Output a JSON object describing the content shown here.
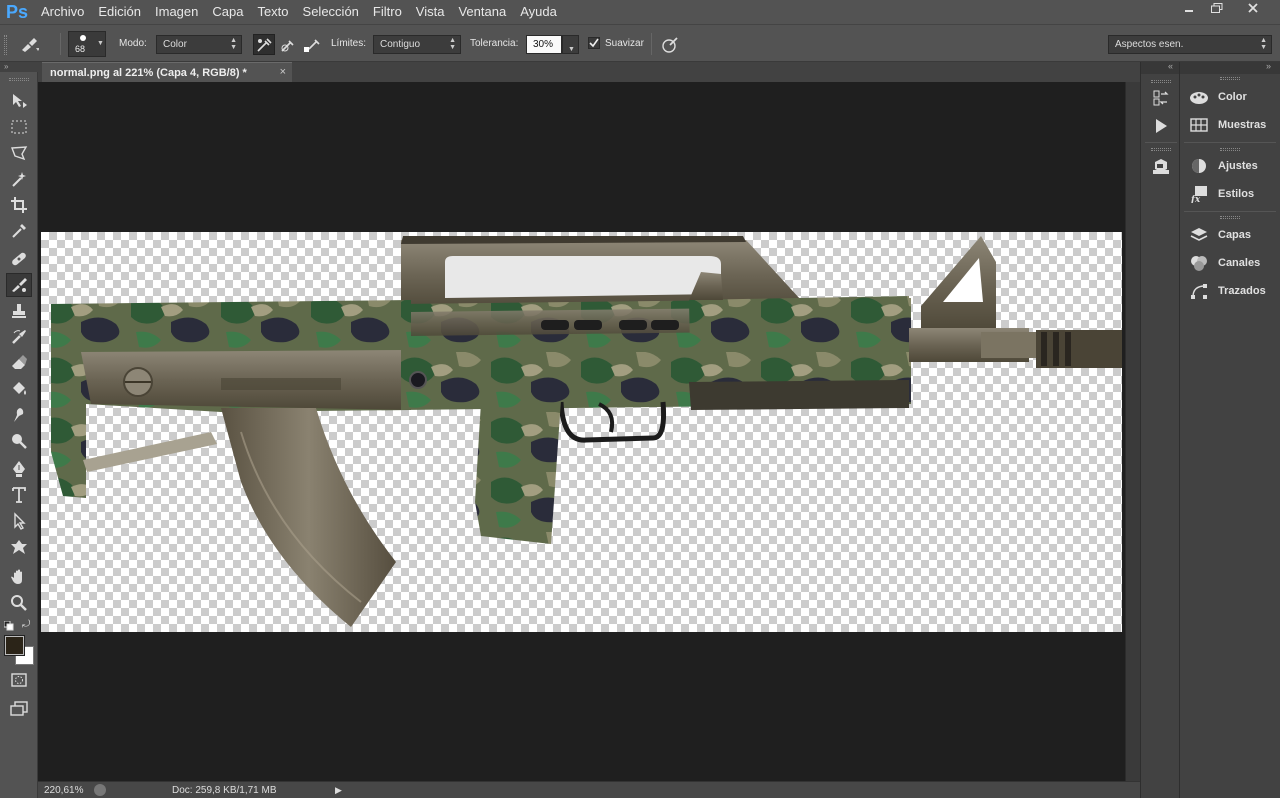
{
  "app": {
    "logo": "Ps"
  },
  "menu": [
    "Archivo",
    "Edición",
    "Imagen",
    "Capa",
    "Texto",
    "Selección",
    "Filtro",
    "Vista",
    "Ventana",
    "Ayuda"
  ],
  "options": {
    "brush_size": "68",
    "mode_label": "Modo:",
    "mode_value": "Color",
    "limits_label": "Límites:",
    "limits_value": "Contiguo",
    "tolerance_label": "Tolerancia:",
    "tolerance_value": "30%",
    "smooth_label": "Suavizar",
    "smooth_checked": true,
    "workspace_value": "Aspectos esen."
  },
  "document": {
    "tab_title": "normal.png al 221% (Capa 4, RGB/8) *",
    "close_glyph": "×"
  },
  "status": {
    "zoom": "220,61%",
    "doc_info": "Doc: 259,8 KB/1,71 MB"
  },
  "panels": {
    "group1": [
      "Color",
      "Muestras"
    ],
    "group2": [
      "Ajustes",
      "Estilos"
    ],
    "group3": [
      "Capas",
      "Canales",
      "Trazados"
    ]
  },
  "colors": {
    "foreground": "#2b2418",
    "background": "#ffffff",
    "chrome": "#535353",
    "workspace": "#1f1f1f"
  }
}
